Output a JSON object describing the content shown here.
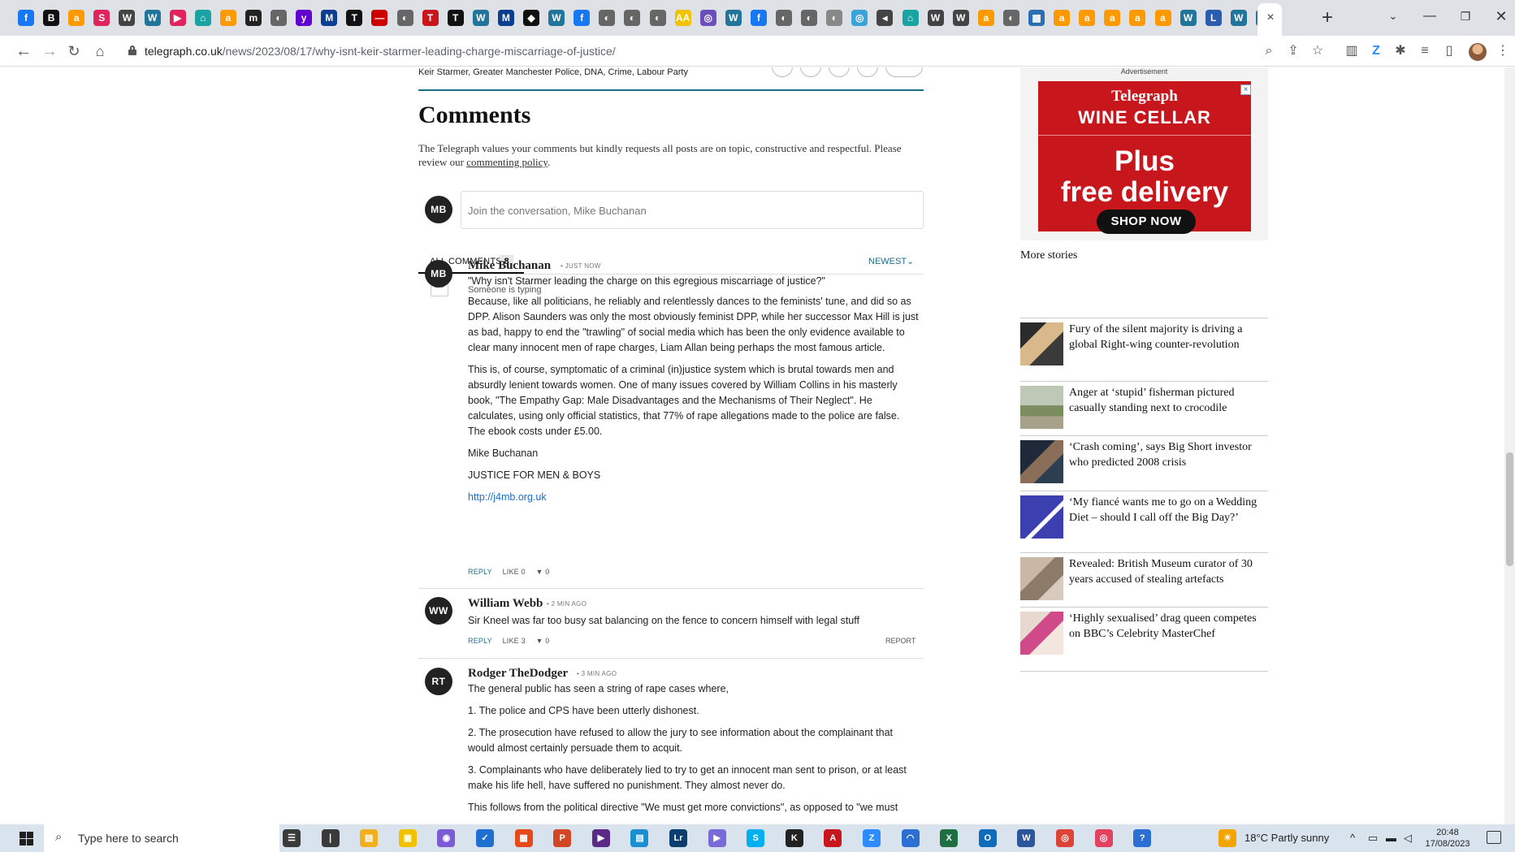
{
  "browser": {
    "url_host": "telegraph.co.uk",
    "url_path": "/news/2023/08/17/why-isnt-keir-starmer-leading-charge-miscarriage-of-justice/",
    "tab_close": "×",
    "new_tab": "+",
    "tab_icons": [
      {
        "glyph": "f",
        "color": "#1877f2"
      },
      {
        "glyph": "B",
        "color": "#111111"
      },
      {
        "glyph": "a",
        "color": "#ff9900"
      },
      {
        "glyph": "S",
        "color": "#e0245e"
      },
      {
        "glyph": "W",
        "color": "#444444"
      },
      {
        "glyph": "W",
        "color": "#21759b"
      },
      {
        "glyph": "▶",
        "color": "#e0245e"
      },
      {
        "glyph": "⌂",
        "color": "#1aa3a3"
      },
      {
        "glyph": "a",
        "color": "#ff9900"
      },
      {
        "glyph": "m",
        "color": "#222222"
      },
      {
        "glyph": "◐",
        "color": "#666666"
      },
      {
        "glyph": "y",
        "color": "#6001d2"
      },
      {
        "glyph": "M",
        "color": "#0b3d91"
      },
      {
        "glyph": "T",
        "color": "#111111"
      },
      {
        "glyph": "—",
        "color": "#cc0000"
      },
      {
        "glyph": "◐",
        "color": "#666666"
      },
      {
        "glyph": "T",
        "color": "#c8161d"
      },
      {
        "glyph": "T",
        "color": "#111111"
      },
      {
        "glyph": "W",
        "color": "#21759b"
      },
      {
        "glyph": "M",
        "color": "#0b3d91"
      },
      {
        "glyph": "◆",
        "color": "#111111"
      },
      {
        "glyph": "W",
        "color": "#21759b"
      },
      {
        "glyph": "f",
        "color": "#1877f2"
      },
      {
        "glyph": "◐",
        "color": "#666666"
      },
      {
        "glyph": "◐",
        "color": "#666666"
      },
      {
        "glyph": "◐",
        "color": "#666666"
      },
      {
        "glyph": "AA",
        "color": "#f2c200"
      },
      {
        "glyph": "◎",
        "color": "#6b4fbb"
      },
      {
        "glyph": "W",
        "color": "#21759b"
      },
      {
        "glyph": "f",
        "color": "#1877f2"
      },
      {
        "glyph": "◐",
        "color": "#666666"
      },
      {
        "glyph": "◐",
        "color": "#666666"
      },
      {
        "glyph": "◐",
        "color": "#888888"
      },
      {
        "glyph": "◎",
        "color": "#3aa3d8"
      },
      {
        "glyph": "◂",
        "color": "#444444"
      },
      {
        "glyph": "⌂",
        "color": "#1aa3a3"
      },
      {
        "glyph": "W",
        "color": "#444444"
      },
      {
        "glyph": "W",
        "color": "#444444"
      },
      {
        "glyph": "a",
        "color": "#ff9900"
      },
      {
        "glyph": "◐",
        "color": "#666666"
      },
      {
        "glyph": "▦",
        "color": "#2a6fb0"
      },
      {
        "glyph": "a",
        "color": "#ff9900"
      },
      {
        "glyph": "a",
        "color": "#ff9900"
      },
      {
        "glyph": "a",
        "color": "#ff9900"
      },
      {
        "glyph": "a",
        "color": "#ff9900"
      },
      {
        "glyph": "a",
        "color": "#ff9900"
      },
      {
        "glyph": "W",
        "color": "#21759b"
      },
      {
        "glyph": "L",
        "color": "#2a5db0"
      },
      {
        "glyph": "W",
        "color": "#21759b"
      },
      {
        "glyph": "W",
        "color": "#21759b"
      }
    ]
  },
  "article": {
    "tags": "Keir Starmer, Greater Manchester Police, DNA, Crime, Labour Party"
  },
  "comments": {
    "title": "Comments",
    "intro_text": "The Telegraph values your comments but kindly requests all posts are on topic, constructive and respectful. Please review our ",
    "policy_link": "commenting policy",
    "intro_end": ".",
    "current_user_initials": "MB",
    "join_placeholder": "Join the conversation, Mike Buchanan",
    "tab_label": "ALL COMMENTS",
    "tab_count": "8",
    "sort_label": "NEWEST",
    "typing_indicator": "Someone is typing",
    "items": [
      {
        "initials": "MB",
        "author": "Mike Buchanan",
        "time": "• JUST NOW",
        "paragraphs": [
          "\"Why isn't Starmer leading the charge on this egregious miscarriage of justice?\"",
          "Because, like all politicians, he reliably and relentlessly dances to the feminists' tune, and did so as DPP. Alison Saunders was only the most obviously feminist DPP, while her successor Max Hill is just as bad, happy to end the \"trawling\" of social media which has been the only evidence available to clear many innocent men of rape charges, Liam Allan being perhaps the most famous article.",
          "This is, of course, symptomatic of a criminal (in)justice system which is brutal towards men and absurdly lenient towards women. One of many issues covered by William Collins in his masterly book, \"The Empathy Gap: Male Disadvantages and the Mechanisms of Their Neglect\". He calculates, using only official statistics, that 77% of rape allegations made to the police are false. The ebook costs under £5.00.",
          "Mike Buchanan",
          "JUSTICE FOR MEN & BOYS"
        ],
        "link": "http://j4mb.org.uk",
        "reply": "REPLY",
        "like": "LIKE 0",
        "dislike": "0"
      },
      {
        "initials": "WW",
        "author": "William Webb",
        "time": "• 2 MIN AGO",
        "paragraphs": [
          "Sir Kneel was far too busy sat balancing on the fence to concern himself with legal stuff"
        ],
        "reply": "REPLY",
        "like": "LIKE 3",
        "dislike": "0",
        "report": "REPORT"
      },
      {
        "initials": "RT",
        "author": "Rodger TheDodger",
        "time": "• 3 MIN AGO",
        "paragraphs": [
          "The general public has seen a string of rape cases where,",
          "1. The police and CPS have been utterly dishonest.",
          "2. The prosecution have refused to allow the jury to see information about the complainant that would almost certainly persuade them to acquit.",
          "3. Complainants who have deliberately lied to try to get an innocent man sent to prison, or at least make his life hell, have suffered no punishment. They almost never do.",
          "This follows from the political directive \"We must get more convictions\", as opposed to \"we must"
        ]
      }
    ]
  },
  "sidebar": {
    "ad_label": "Advertisement",
    "ad": {
      "brand": "Telegraph",
      "product": "WINE CELLAR",
      "headline_1": "Plus",
      "headline_2": "free delivery",
      "cta": "SHOP NOW",
      "close": "×",
      "color": "#c8161d"
    },
    "more_stories_title": "More stories",
    "stories": [
      {
        "title": "Fury of the silent majority is driving a global Right-wing counter-revolution",
        "thumb": "linear-gradient(135deg,#2b2b2b 0 30%,#d9b98c 31% 60%,#3a3a3a 61%)"
      },
      {
        "title": "Anger at ‘stupid’ fisherman pictured casually standing next to crocodile",
        "thumb": "linear-gradient(180deg,#bfc7b6 0 45%,#7b8c5f 46% 70%,#a9a28a 71%)"
      },
      {
        "title": "‘Crash coming’, says Big Short investor who predicted 2008 crisis",
        "thumb": "linear-gradient(135deg,#1e2a3a 0 40%,#8a6e5a 41% 65%,#2c3e50 66%)"
      },
      {
        "title": "‘My fiancé wants me to go on a Wedding Diet – should I call off the Big Day?’",
        "thumb": "linear-gradient(135deg,#3b3fb0 0 55%,#ffffff 56% 62%,#3b3fb0 63%)"
      },
      {
        "title": "Revealed: British Museum curator of 30 years accused of stealing artefacts",
        "thumb": "linear-gradient(135deg,#c9b8a6 0 40%,#8d7b6a 41% 70%,#d8cbbd 71%)"
      },
      {
        "title": "‘Highly sexualised’ drag queen competes on BBC’s Celebrity MasterChef",
        "thumb": "linear-gradient(135deg,#e8d9d0 0 35%,#d04a8a 36% 60%,#f2e6df 61%)"
      }
    ]
  },
  "taskbar": {
    "search_placeholder": "Type here to search",
    "weather": "18°C  Partly sunny",
    "time": "20:48",
    "date": "17/08/2023",
    "apps": [
      {
        "glyph": "☰",
        "color": "#3a3a3a"
      },
      {
        "glyph": "❘",
        "color": "#3a3a3a"
      },
      {
        "glyph": "▤",
        "color": "#f2b01e"
      },
      {
        "glyph": "▣",
        "color": "#f2c200"
      },
      {
        "glyph": "◉",
        "color": "#7b5bd6"
      },
      {
        "glyph": "✓",
        "color": "#1f6fd1"
      },
      {
        "glyph": "▦",
        "color": "#e64a19"
      },
      {
        "glyph": "P",
        "color": "#d24726"
      },
      {
        "glyph": "▶",
        "color": "#5b2a86"
      },
      {
        "glyph": "▤",
        "color": "#1a8fd1"
      },
      {
        "glyph": "Lr",
        "color": "#0b3d6e"
      },
      {
        "glyph": "▶",
        "color": "#7a6ad8"
      },
      {
        "glyph": "S",
        "color": "#00aff0"
      },
      {
        "glyph": "K",
        "color": "#222222"
      },
      {
        "glyph": "A",
        "color": "#c8161d"
      },
      {
        "glyph": "Z",
        "color": "#2d8cff"
      },
      {
        "glyph": "◠",
        "color": "#2a6fd1"
      },
      {
        "glyph": "X",
        "color": "#1d6f42"
      },
      {
        "glyph": "O",
        "color": "#0f6cbd"
      },
      {
        "glyph": "W",
        "color": "#2b579a"
      },
      {
        "glyph": "◎",
        "color": "#db4437"
      },
      {
        "glyph": "◎",
        "color": "#e4405f"
      },
      {
        "glyph": "?",
        "color": "#2a6fd1"
      }
    ]
  }
}
